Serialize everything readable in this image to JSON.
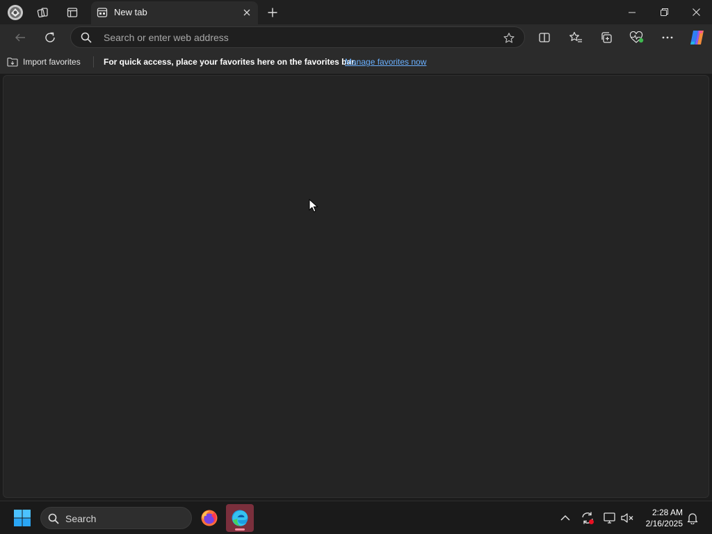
{
  "tab": {
    "title": "New tab"
  },
  "omnibox": {
    "placeholder": "Search or enter web address"
  },
  "favorites_bar": {
    "import_label": "Import favorites",
    "message": "For quick access, place your favorites here on the favorites bar.",
    "manage_link": "Manage favorites now"
  },
  "taskbar": {
    "search_label": "Search",
    "time": "2:28 AM",
    "date": "2/16/2025"
  },
  "colors": {
    "accent_link": "#6ab0ff",
    "active_app_bg": "#7a2f3c"
  }
}
